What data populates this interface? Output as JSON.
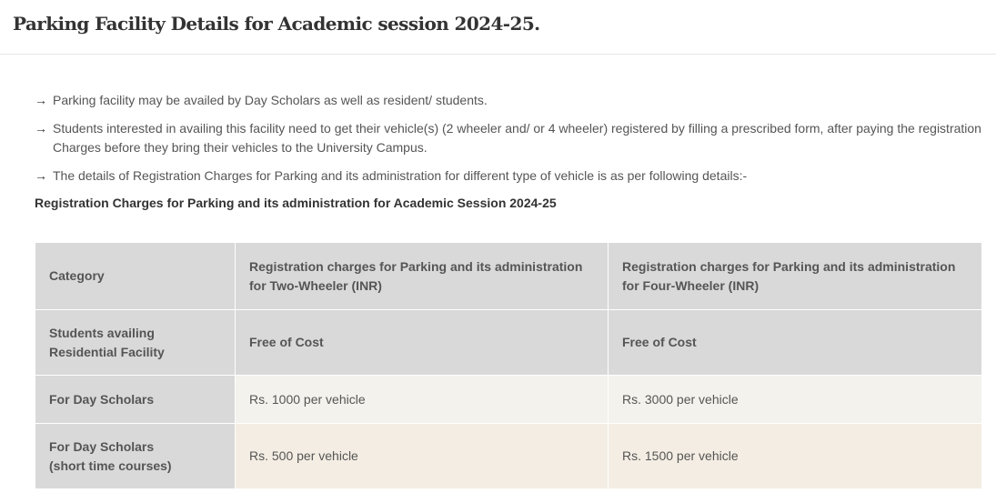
{
  "page": {
    "title": "Parking Facility Details for Academic session 2024-25."
  },
  "bullets": [
    "Parking facility may be availed by Day Scholars as well as resident/ students.",
    "Students interested in availing this facility need to get their vehicle(s) (2 wheeler and/ or 4 wheeler) registered by filling a prescribed form, after paying the registration Charges before they bring their vehicles to the University Campus.",
    "The details of Registration Charges for Parking and its administration for different type of vehicle is as per following details:-"
  ],
  "bullet_icon": "arrow-right-icon",
  "subheading": "Registration Charges for Parking and its administration for Academic Session 2024-25",
  "table": {
    "headers": [
      "Category",
      "Registration charges for Parking and its administration for Two-Wheeler (INR)",
      "Registration charges for Parking and its administration for Four-Wheeler (INR)"
    ],
    "rows": [
      {
        "category_line1": "Students availing",
        "category_line2": "Residential Facility",
        "two_wheeler": "Free of Cost",
        "four_wheeler": "Free of Cost"
      },
      {
        "category_line1": "For Day Scholars",
        "category_line2": "",
        "two_wheeler": "Rs. 1000 per vehicle",
        "four_wheeler": "Rs. 3000 per vehicle"
      },
      {
        "category_line1": "For Day Scholars",
        "category_line2": "(short time courses)",
        "two_wheeler": "Rs. 500 per vehicle",
        "four_wheeler": "Rs. 1500 per vehicle"
      }
    ]
  },
  "colors": {
    "header_bg": "#d9d9d9",
    "row_day_bg": "#f3f2ec",
    "row_short_bg": "#f4ede3",
    "text": "#555555"
  }
}
